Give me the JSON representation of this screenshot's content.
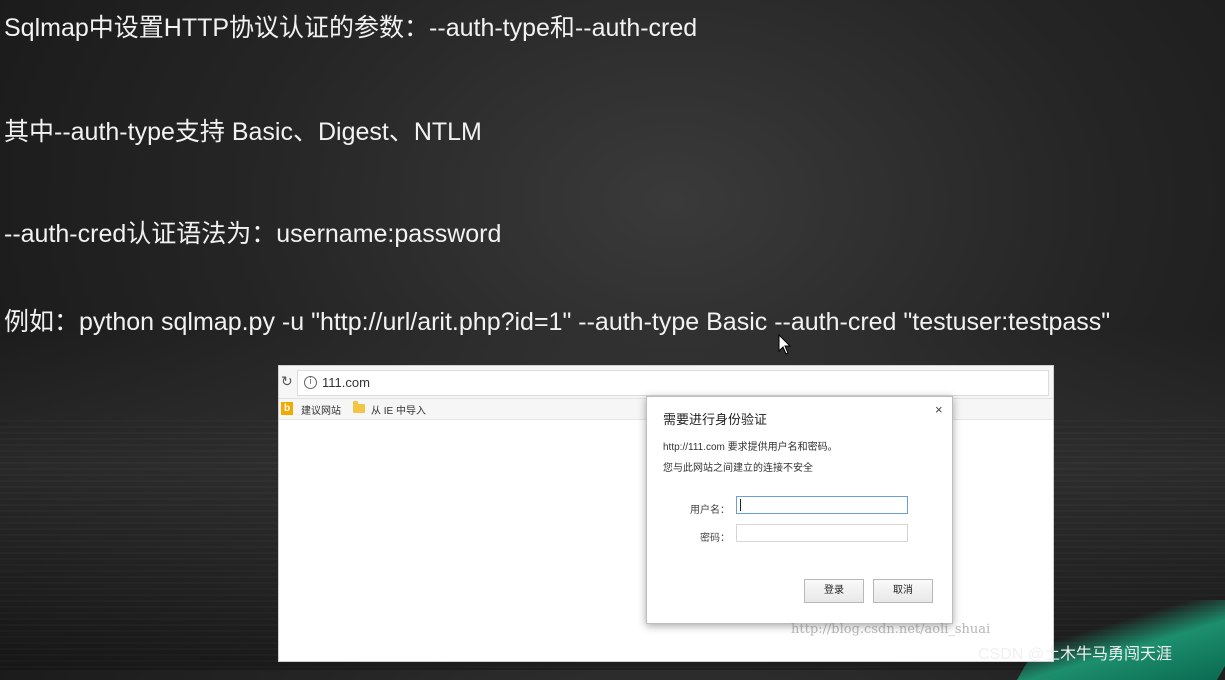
{
  "slide": {
    "line1": "Sqlmap中设置HTTP协议认证的参数：--auth-type和--auth-cred",
    "line2": "其中--auth-type支持  Basic、Digest、NTLM",
    "line3": "--auth-cred认证语法为：username:password",
    "line4": "例如：python sqlmap.py -u \"http://url/arit.php?id=1\" --auth-type Basic --auth-cred \"testuser:testpass\""
  },
  "browser": {
    "url": "111.com",
    "bookmarks": [
      {
        "label": "建议网站",
        "icon": "bing-icon"
      },
      {
        "label": "从 IE 中导入",
        "icon": "folder-icon"
      }
    ],
    "watermark": "http://blog.csdn.net/aoli_shuai"
  },
  "auth_dialog": {
    "title": "需要进行身份验证",
    "message_line1": "http://111.com 要求提供用户名和密码。",
    "message_line2": "您与此网站之间建立的连接不安全",
    "username_label": "用户名：",
    "username_value": "",
    "password_label": "密码：",
    "password_value": "",
    "login_button": "登录",
    "cancel_button": "取消",
    "close_icon": "×"
  },
  "credit": "CSDN @土木牛马勇闯天涯",
  "colors": {
    "slide_background": "#252525",
    "slide_text": "#f2f2f2",
    "accent_green": "#1d8f6d"
  }
}
